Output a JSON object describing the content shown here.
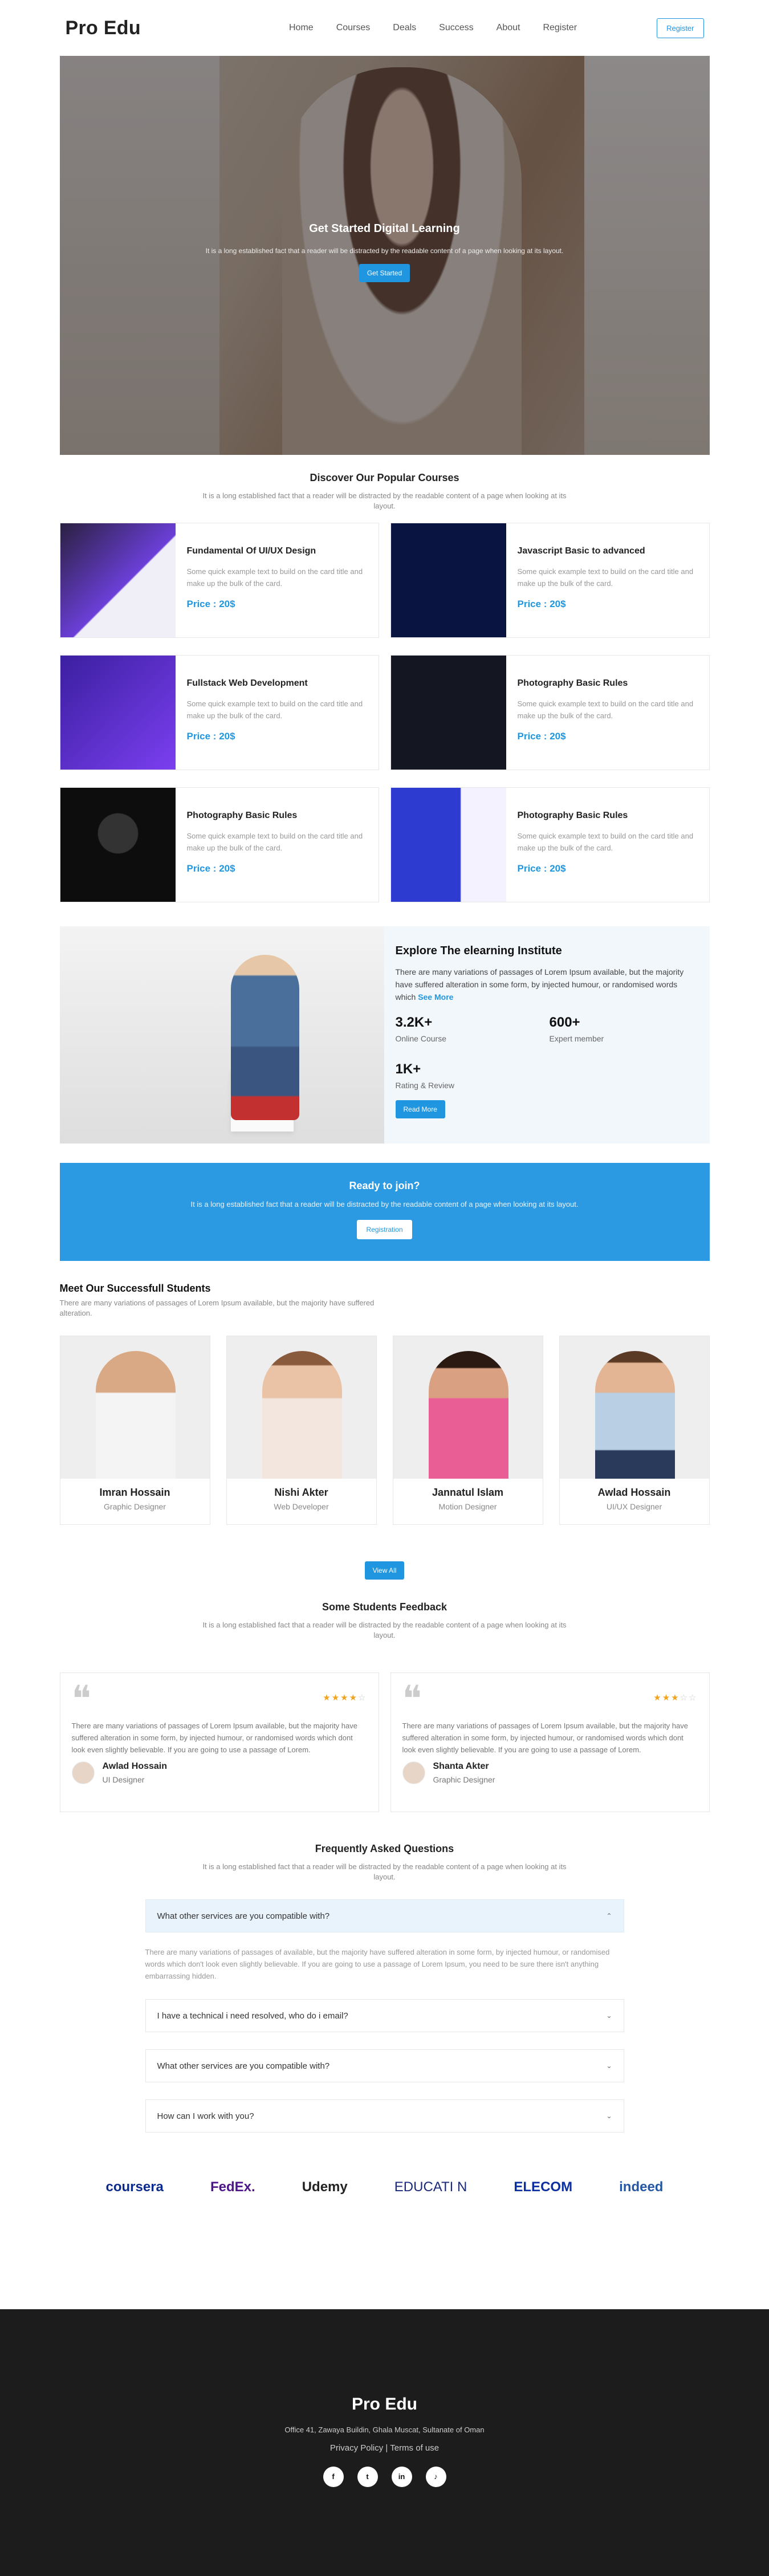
{
  "header": {
    "logo": "Pro Edu",
    "nav": [
      "Home",
      "Courses",
      "Deals",
      "Success",
      "About",
      "Register"
    ],
    "register_btn": "Register"
  },
  "hero": {
    "title": "Get Started Digital Learning",
    "subtitle": "It is a long established fact that a reader will be distracted by the readable content of a page when looking at its layout.",
    "button": "Get Started"
  },
  "popular": {
    "title": "Discover Our Popular Courses",
    "subtitle": "It is a long established fact that a reader will be distracted by the readable content of a page when looking at its layout.",
    "courses": [
      {
        "title": "Fundamental Of UI/UX Design",
        "desc": "Some quick example text to build on the card title and make up the bulk of the card.",
        "price": "Price : 20$"
      },
      {
        "title": "Javascript Basic to advanced",
        "desc": "Some quick example text to build on the card title and make up the bulk of the card.",
        "price": "Price : 20$"
      },
      {
        "title": "Fullstack Web Development",
        "desc": "Some quick example text to build on the card title and make up the bulk of the card.",
        "price": "Price : 20$"
      },
      {
        "title": "Photography Basic Rules",
        "desc": "Some quick example text to build on the card title and make up the bulk of the card.",
        "price": "Price : 20$"
      },
      {
        "title": "Photography Basic Rules",
        "desc": "Some quick example text to build on the card title and make up the bulk of the card.",
        "price": "Price : 20$"
      },
      {
        "title": "Photography Basic Rules",
        "desc": "Some quick example text to build on the card title and make up the bulk of the card.",
        "price": "Price : 20$"
      }
    ]
  },
  "explore": {
    "title": "Explore The elearning Institute",
    "desc": "There are many variations of passages of Lorem Ipsum available, but the majority have suffered alteration in some form, by injected humour, or randomised words which",
    "see_more": "See More",
    "stats": [
      {
        "num": "3.2K+",
        "label": "Online Course"
      },
      {
        "num": "600+",
        "label": "Expert member"
      },
      {
        "num": "1K+",
        "label": "Rating & Review"
      }
    ],
    "button": "Read More"
  },
  "join": {
    "title": "Ready to join?",
    "text": "It is a long established fact that a reader will be distracted by the readable content of a page when looking at its layout.",
    "button": "Registration"
  },
  "students": {
    "title": "Meet Our Successfull Students",
    "subtitle": "There are many variations of passages of Lorem Ipsum available, but the majority have suffered alteration.",
    "items": [
      {
        "name": "Imran Hossain",
        "role": "Graphic Designer"
      },
      {
        "name": "Nishi Akter",
        "role": "Web Developer"
      },
      {
        "name": "Jannatul Islam",
        "role": "Motion Designer"
      },
      {
        "name": "Awlad Hossain",
        "role": "UI/UX Designer"
      }
    ],
    "button": "View All"
  },
  "feedback": {
    "title": "Some Students Feedback",
    "subtitle": "It is a long established fact that a reader will be distracted by the readable content of a page when looking at its layout.",
    "items": [
      {
        "text": "There are many variations of passages of Lorem Ipsum available, but the majority have suffered alteration in some form, by injected humour, or randomised words which dont look even slightly believable. If you are going to use a passage of Lorem.",
        "name": "Awlad Hossain",
        "role": "UI Designer",
        "rating": 4
      },
      {
        "text": "There are many variations of passages of Lorem Ipsum available, but the majority have suffered alteration in some form, by injected humour, or randomised words which dont look even slightly believable. If you are going to use a passage of Lorem.",
        "name": "Shanta Akter",
        "role": "Graphic Designer",
        "rating": 3
      }
    ]
  },
  "faq": {
    "title": "Frequently Asked Questions",
    "subtitle": "It is a long established fact that a reader will be distracted by the readable content of a page when looking at its layout.",
    "items": [
      {
        "q": "What other services are you compatible with?",
        "open": true
      },
      {
        "q": "I have a technical i need resolved, who do i email?",
        "open": false
      },
      {
        "q": "What other services are you compatible with?",
        "open": false
      },
      {
        "q": "How can I work with you?",
        "open": false
      }
    ],
    "answer": "There are many variations of passages of available, but the majority have suffered alteration in some form, by injected humour, or randomised words which don't look even slightly believable. If you are going to use a passage of Lorem Ipsum, you need to be sure there isn't anything embarrassing hidden."
  },
  "logos": [
    {
      "text": "coursera",
      "color": "#0a2a8c"
    },
    {
      "text": "FedEx.",
      "color": "#4d148c"
    },
    {
      "text": "Udemy",
      "color": "#222222"
    },
    {
      "text": "EDUCATI N",
      "color": "#1b2a7a"
    },
    {
      "text": "ELECOM",
      "color": "#0b2fa0"
    },
    {
      "text": "indeed",
      "color": "#2557a7"
    }
  ],
  "footer": {
    "logo": "Pro Edu",
    "address": "Office 41, Zawaya Buildin, Ghala Muscat, Sultanate of Oman",
    "links": "Privacy Policy | Terms of use",
    "socials": [
      "facebook-icon",
      "twitter-icon",
      "linkedin-icon",
      "tiktok-icon"
    ]
  }
}
